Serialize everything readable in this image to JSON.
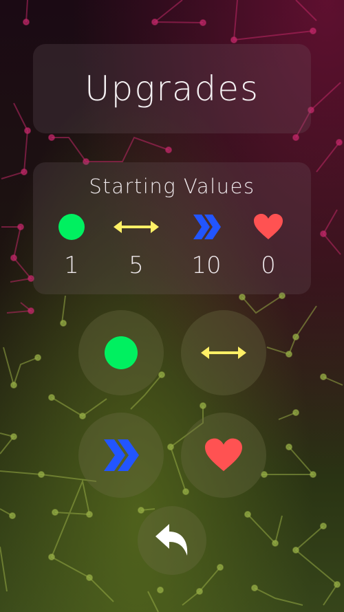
{
  "title": "Upgrades",
  "starting_values": {
    "heading": "Starting Values",
    "items": [
      {
        "icon": "green-circle-icon",
        "value": "1"
      },
      {
        "icon": "double-arrow-icon",
        "value": "5"
      },
      {
        "icon": "speed-chevrons-icon",
        "value": "10"
      },
      {
        "icon": "heart-icon",
        "value": "0"
      }
    ]
  },
  "buttons": [
    {
      "icon": "green-circle-icon"
    },
    {
      "icon": "double-arrow-icon"
    },
    {
      "icon": "speed-chevrons-icon"
    },
    {
      "icon": "heart-icon"
    },
    {
      "icon": "back-arrow-icon"
    }
  ],
  "colors": {
    "green": "#00f060",
    "yellow": "#fff066",
    "blue": "#2255ff",
    "red": "#ff5252"
  }
}
